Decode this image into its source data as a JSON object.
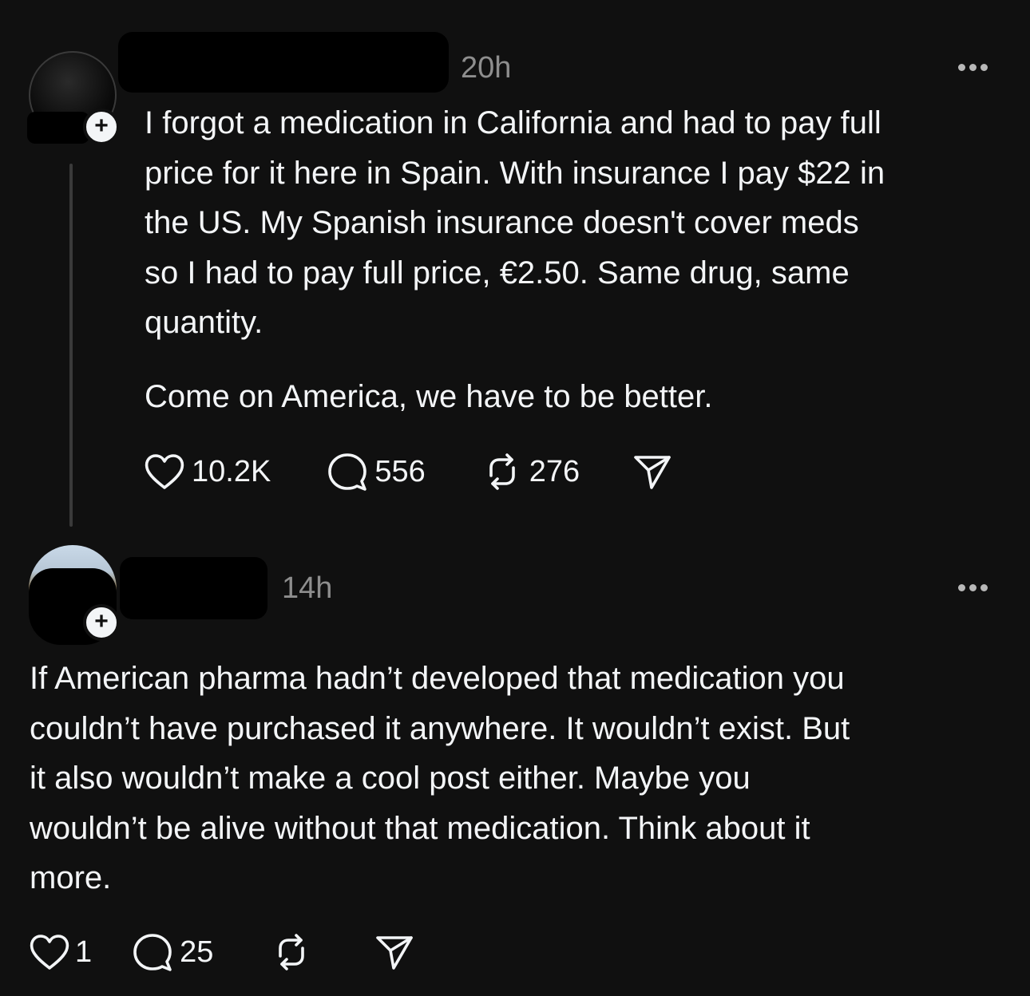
{
  "posts": [
    {
      "time": "20h",
      "paragraphs": [
        "I forgot a medication in California and had to pay full\nprice for it here in Spain. With insurance I pay $22 in\nthe US. My Spanish insurance doesn't cover meds\nso I had to pay full price, €2.50. Same drug, same\nquantity.",
        "Come on America, we have to be better."
      ],
      "likes": "10.2K",
      "replies": "556",
      "reposts": "276"
    },
    {
      "time": "14h",
      "paragraphs": [
        "If American pharma hadn’t developed that medication you\ncouldn’t have purchased it anywhere. It wouldn’t exist. But\nit also wouldn’t make a cool post either. Maybe you\nwouldn’t be alive without that medication. Think about it\nmore."
      ],
      "likes": "1",
      "replies": "25",
      "reposts": ""
    }
  ],
  "icons": {
    "like": "heart-icon",
    "reply": "comment-bubble-icon",
    "repost": "repost-arrows-icon",
    "share": "paper-plane-icon",
    "more": "more-dots-icon",
    "follow": "plus-icon"
  },
  "colors": {
    "background": "#101010",
    "text": "#f3f5f7",
    "muted": "#8e8e8e",
    "thread_line": "#3a3a3a"
  }
}
